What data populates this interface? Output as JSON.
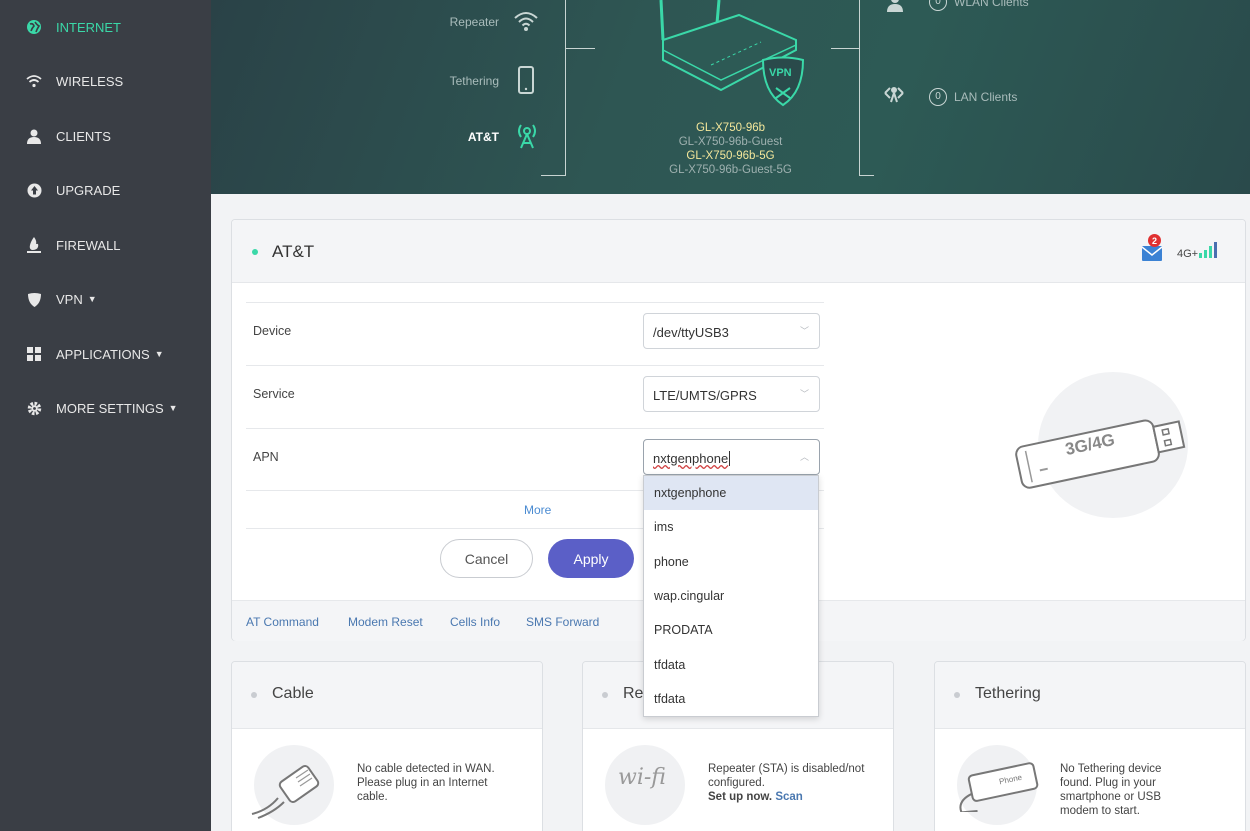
{
  "sidebar": {
    "items": [
      {
        "label": "INTERNET",
        "icon": "globe-icon"
      },
      {
        "label": "WIRELESS",
        "icon": "wifi-icon"
      },
      {
        "label": "CLIENTS",
        "icon": "user-icon"
      },
      {
        "label": "UPGRADE",
        "icon": "upgrade-icon"
      },
      {
        "label": "FIREWALL",
        "icon": "firewall-icon"
      },
      {
        "label": "VPN",
        "icon": "shield-icon"
      },
      {
        "label": "APPLICATIONS",
        "icon": "grid-icon"
      },
      {
        "label": "MORE SETTINGS",
        "icon": "gear-icon"
      }
    ]
  },
  "hero": {
    "repeater": "Repeater",
    "tethering": "Tethering",
    "carrier": "AT&T",
    "wlan_count": "0",
    "wlan_clients": "WLAN Clients",
    "lan_count": "0",
    "lan_clients": "LAN Clients",
    "vpn_badge": "VPN",
    "ssids": [
      "GL-X750-96b",
      "GL-X750-96b-Guest",
      "GL-X750-96b-5G",
      "GL-X750-96b-Guest-5G"
    ]
  },
  "modem_card": {
    "title": "AT&T",
    "network_type": "4G+",
    "message_count": "2",
    "device_label": "Device",
    "device_value": "/dev/ttyUSB3",
    "service_label": "Service",
    "service_value": "LTE/UMTS/GPRS",
    "apn_label": "APN",
    "apn_value": "nxtgenphone",
    "more_label": "More",
    "cancel_label": "Cancel",
    "apply_label": "Apply",
    "dongle_text": "3G/4G",
    "footer_links": [
      "AT Command",
      "Modem Reset",
      "Cells Info",
      "SMS Forward"
    ]
  },
  "apn_dropdown": {
    "options": [
      "nxtgenphone",
      "ims",
      "phone",
      "wap.cingular",
      "PRODATA",
      "tfdata",
      "tfdata"
    ],
    "selected_index": 0
  },
  "bottom_cards": {
    "cable": {
      "title": "Cable",
      "text": "No cable detected in WAN. Please plug in an Internet cable."
    },
    "repeater": {
      "title": "Repeater",
      "text": "Repeater (STA) is disabled/not configured.",
      "setup": "Set up now.",
      "scan": "Scan",
      "wifi_text": "wi-fi"
    },
    "tethering": {
      "title": "Tethering",
      "text": "No Tethering device found. Plug in your smartphone or USB modem to start.",
      "phone_text": "Phone"
    }
  },
  "colors": {
    "accent": "#3ad8a8",
    "sidebar": "#3a3e45",
    "apply": "#5b5fc7",
    "link": "#4a78b0"
  }
}
